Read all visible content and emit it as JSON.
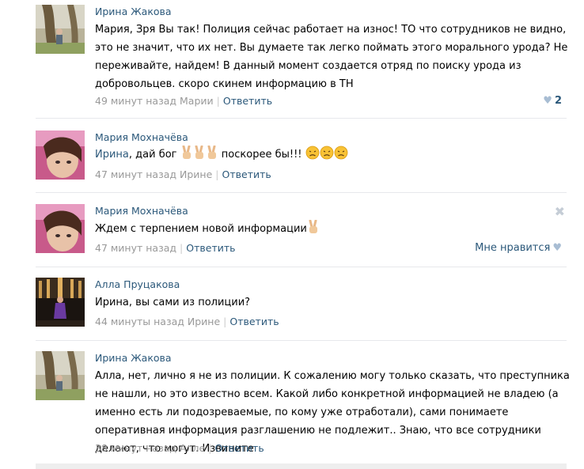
{
  "comments": [
    {
      "author": "Ирина Жакова",
      "text": "Мария, Зря Вы так! Полиция сейчас работает на износ! ТО что сотрудников не видно, это не значит, что их нет. Вы думаете так легко поймать этого морального урода? Не переживайте, найдем! В данный момент создается отряд по поиску урода из добровольцев. скоро скинем информацию в ТН",
      "time": "49 минут назад Марии",
      "reply_label": "Ответить",
      "like_count": "2"
    },
    {
      "author": "Мария Мохначёва",
      "text_prefix": "Ирина",
      "text_main": ", дай бог",
      "text_suffix": " поскорее бы!!!",
      "time": "47 минут назад Ирине",
      "reply_label": "Ответить"
    },
    {
      "author": "Мария Мохначёва",
      "text": "Ждем с терпением новой информации",
      "time": "47 минут назад",
      "reply_label": "Ответить",
      "like_label": "Мне нравится"
    },
    {
      "author": "Алла Пруцакова",
      "text": "Ирина, вы сами из полиции?",
      "time": "44 минуты назад Ирине",
      "reply_label": "Ответить"
    },
    {
      "author": "Ирина Жакова",
      "text": "Алла, нет, лично я не из полиции. К сожалению могу только сказать, что преступника не нашли, но это известно всем. Какой либо конкретной информацией не владею (а именно есть ли подозреваемые, по кому уже отработали), сами понимаете оперативная информация разглашению не подлежит.. Знаю, что все сотрудники делают, что могут. Извините",
      "time": "38 минут назад Алле",
      "reply_label": "Ответить"
    }
  ],
  "icons": {
    "heart": "♥",
    "close": "✖",
    "victory_hand": "victory-hand-icon",
    "sad_face": "disappointed-face-icon"
  },
  "colors": {
    "link": "#2b587a",
    "meta": "#999999",
    "divider": "#e7e8ec"
  }
}
